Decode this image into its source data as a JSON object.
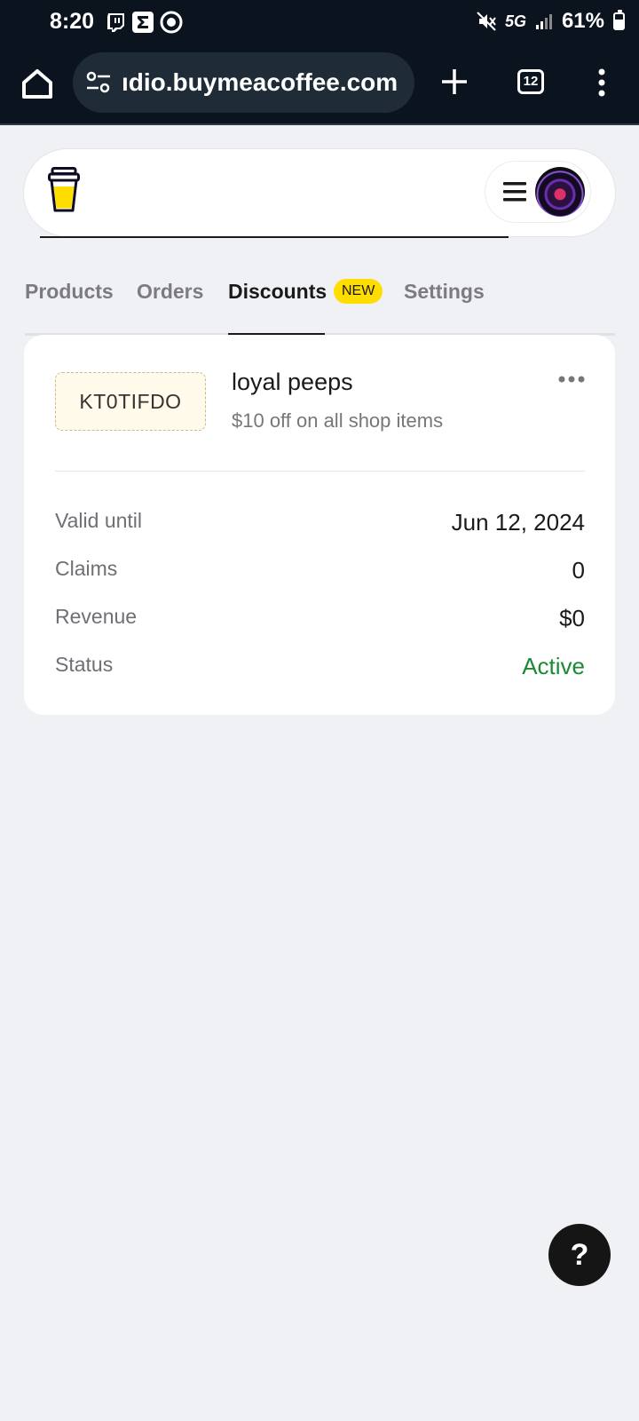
{
  "status_bar": {
    "time": "8:20",
    "network": "5G",
    "battery": "61%",
    "battery_level": 0.61
  },
  "browser": {
    "url": "ıdio.buymeacoffee.com",
    "tab_count": "12"
  },
  "tabs": [
    {
      "label": "Products"
    },
    {
      "label": "Orders"
    },
    {
      "label": "Discounts",
      "active": true,
      "badge": "NEW"
    },
    {
      "label": "Settings"
    }
  ],
  "discount": {
    "code": "KT0TIFDO",
    "name": "loyal peeps",
    "description": "$10 off on all shop items",
    "rows": [
      {
        "label": "Valid until",
        "value": "Jun 12, 2024"
      },
      {
        "label": "Claims",
        "value": "0"
      },
      {
        "label": "Revenue",
        "value": "$0"
      },
      {
        "label": "Status",
        "value": "Active"
      }
    ]
  },
  "help_button": {
    "label": "?"
  },
  "colors": {
    "brand_yellow": "#ffdd00",
    "status_active": "#1a8a34",
    "topbar": "#0b141e"
  }
}
